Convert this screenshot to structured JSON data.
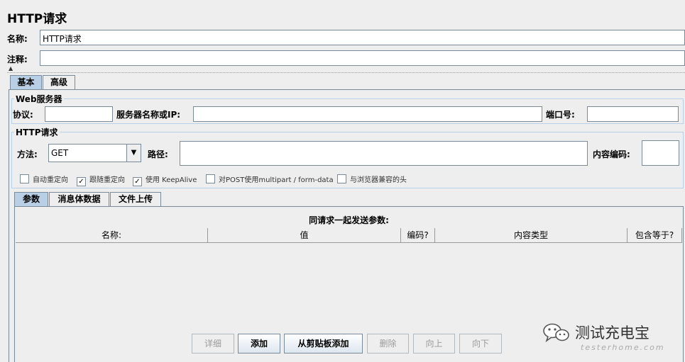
{
  "panel_title": "HTTP请求",
  "name_label": "名称:",
  "name_value": "HTTP请求",
  "comment_label": "注释:",
  "comment_value": "",
  "main_tabs": [
    {
      "label": "基本",
      "active": true
    },
    {
      "label": "高级",
      "active": false
    }
  ],
  "web_server": {
    "title": "Web服务器",
    "protocol_label": "协议:",
    "protocol_value": "",
    "server_label": "服务器名称或IP:",
    "server_value": "",
    "port_label": "端口号:",
    "port_value": ""
  },
  "http_request": {
    "title": "HTTP请求",
    "method_label": "方法:",
    "method_value": "GET",
    "path_label": "路径:",
    "path_value": "",
    "encoding_label": "内容编码:",
    "encoding_value": ""
  },
  "options": [
    {
      "label": "自动重定向",
      "checked": false
    },
    {
      "label": "跟随重定向",
      "checked": true
    },
    {
      "label": "使用 KeepAlive",
      "checked": true
    },
    {
      "label": "对POST使用multipart / form-data",
      "checked": false
    },
    {
      "label": "与浏览器兼容的头",
      "checked": false
    }
  ],
  "param_tabs": [
    {
      "label": "参数",
      "active": true
    },
    {
      "label": "消息体数据",
      "active": false
    },
    {
      "label": "文件上传",
      "active": false
    }
  ],
  "params_table": {
    "caption": "同请求一起发送参数:",
    "columns": [
      "名称:",
      "值",
      "编码?",
      "内容类型",
      "包含等于?"
    ],
    "rows": []
  },
  "buttons": [
    {
      "label": "详细",
      "enabled": false
    },
    {
      "label": "添加",
      "enabled": true
    },
    {
      "label": "从剪贴板添加",
      "enabled": true
    },
    {
      "label": "删除",
      "enabled": false
    },
    {
      "label": "向上",
      "enabled": false
    },
    {
      "label": "向下",
      "enabled": false
    }
  ],
  "watermark": {
    "brand": "测试充电宝",
    "site": "testerhome.com",
    "icon": "wechat-icon"
  },
  "colors": {
    "active_tab": "#b8cfe5",
    "group_border": "#b8cfe5",
    "field_border": "#7a8a99",
    "background": "#eeeeee"
  }
}
